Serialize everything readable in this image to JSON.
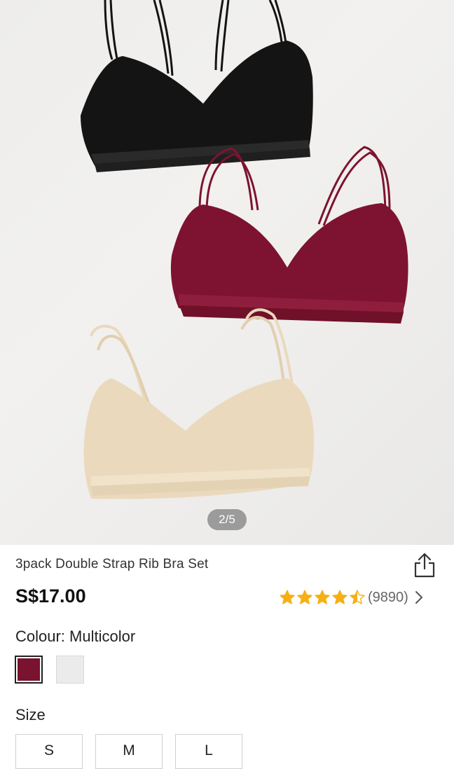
{
  "gallery": {
    "counter": "2/5"
  },
  "product": {
    "title": "3pack Double Strap Rib Bra Set",
    "price": "S$17.00",
    "rating": {
      "value": 4.5,
      "out_of": 5,
      "reviews": "(9890)"
    }
  },
  "colour": {
    "label": "Colour: Multicolor",
    "options": [
      {
        "name": "burgundy",
        "color": "#7a1330",
        "selected": true
      },
      {
        "name": "light-grey",
        "color": "#ebebeb",
        "selected": false
      }
    ]
  },
  "size": {
    "label": "Size",
    "options": [
      "S",
      "M",
      "L"
    ]
  },
  "colors": {
    "star": "#f5b014",
    "bra_black": "#141414",
    "bra_burgundy": "#7d1330",
    "bra_nude": "#ead9bd"
  },
  "icons": {
    "share": "share-icon",
    "chevron": "chevron-right-icon",
    "star": "star-icon"
  }
}
